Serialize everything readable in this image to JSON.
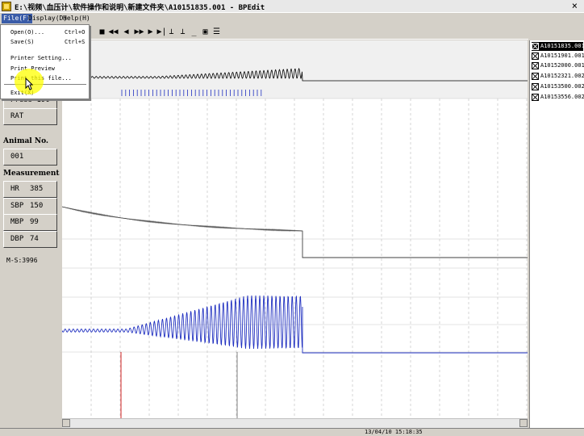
{
  "window": {
    "title": "E:\\视频\\血压计\\软件操作和说明\\新建文件夹\\A10151835.001 - BPEdit",
    "close_glyph": "×"
  },
  "menu": {
    "file": "File(F)",
    "display": "Display(D)",
    "help": "Help(H)"
  },
  "file_menu": [
    {
      "label": "Open(O)...",
      "shortcut": "Ctrl+O"
    },
    {
      "label": "Save(S)",
      "shortcut": "Ctrl+S"
    },
    {
      "label": "Printer Setting...",
      "shortcut": ""
    },
    {
      "label": "Print Preview",
      "shortcut": ""
    },
    {
      "label": "Print this file...",
      "shortcut": ""
    },
    {
      "label": "Exit(X)",
      "shortcut": ""
    }
  ],
  "panel": {
    "press": "Press 190",
    "rat": "RAT",
    "animal_heading": "Animal No.",
    "animal_no": "001",
    "measurement_heading": "Measurement",
    "hr_label": "HR",
    "hr_value": "385",
    "sbp_label": "SBP",
    "sbp_value": "150",
    "mbp_label": "MBP",
    "mbp_value": "99",
    "dbp_label": "DBP",
    "dbp_value": "74",
    "ms": "M-S:3996"
  },
  "files": [
    "A10151835.001",
    "A10151901.001",
    "A10152000.001",
    "A10152321.002",
    "A10153500.002",
    "A10153556.002"
  ],
  "status": {
    "time": "13/04/10 15:18:35"
  },
  "colors": {
    "wave": "#2030c0",
    "marker_red": "#d02020",
    "marker_gray": "#808080"
  }
}
